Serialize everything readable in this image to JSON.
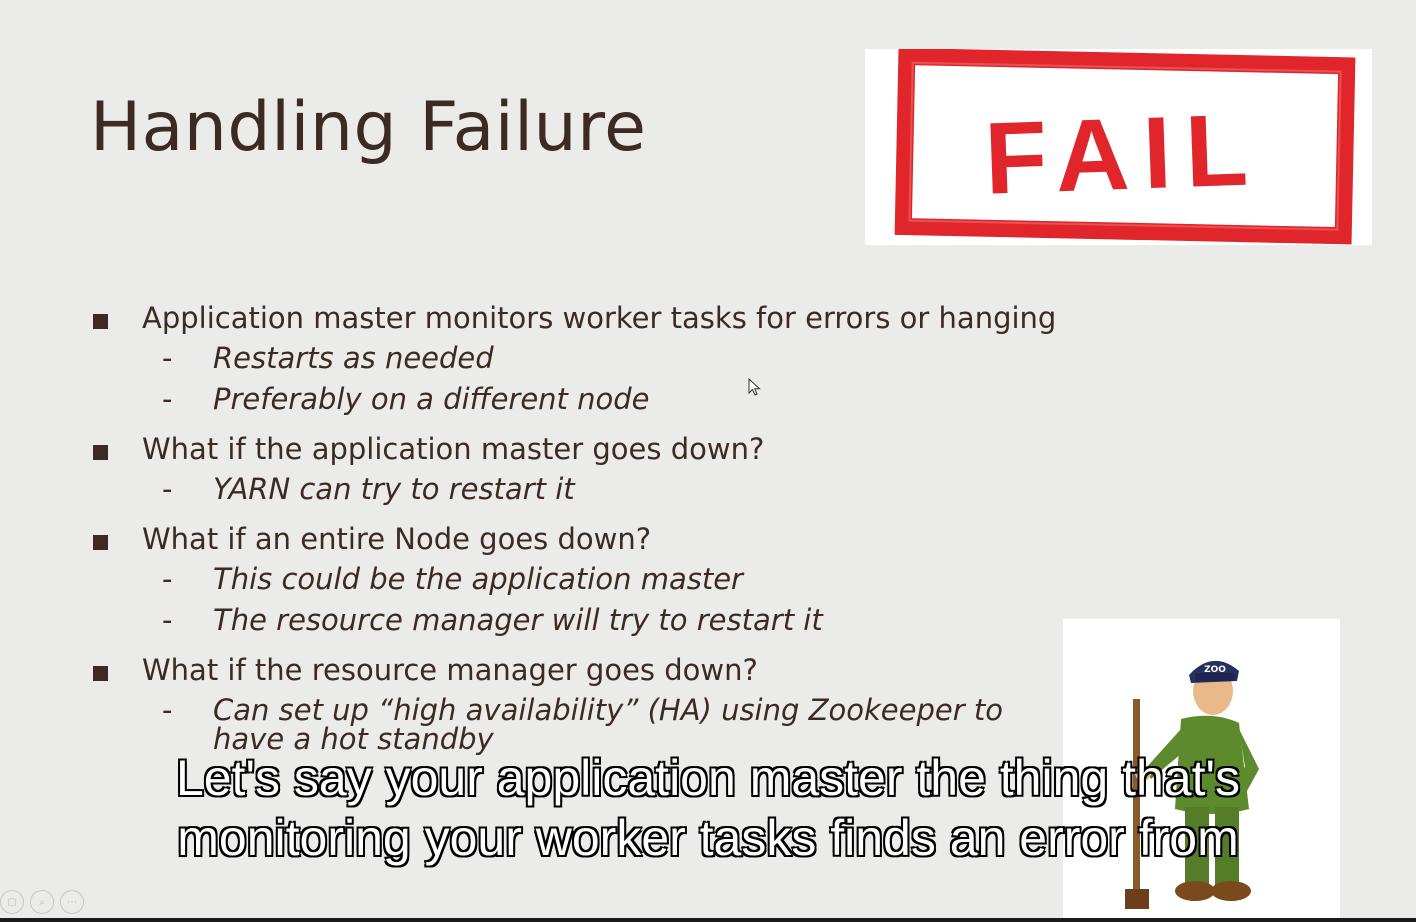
{
  "slide": {
    "title": "Handling Failure",
    "fail_stamp_text": "FAIL",
    "zoo_cap_text": "ZOO",
    "bullets": [
      {
        "text": "Application master monitors worker tasks for errors or hanging",
        "subs": [
          "Restarts as needed",
          "Preferably on a different node"
        ]
      },
      {
        "text": "What if the application master goes down?",
        "subs": [
          "YARN can try to restart it"
        ]
      },
      {
        "text": "What if an entire Node goes down?",
        "subs": [
          "This could be the application master",
          "The resource manager will try to restart it"
        ]
      },
      {
        "text": "What if the resource manager goes down?",
        "subs": [
          "Can set up “high availability” (HA) using Zookeeper to have a hot standby"
        ]
      }
    ],
    "sub_marker": "-"
  },
  "caption": {
    "line1": "Let's say your application master the thing that's",
    "line2": "monitoring your worker tasks finds an error from"
  },
  "colors": {
    "background": "#ebebe9",
    "text": "#3d2a22",
    "stamp_red": "#e0262b"
  },
  "controls": {
    "icons": [
      "copy-icon",
      "zoom-icon",
      "more-icon"
    ]
  }
}
